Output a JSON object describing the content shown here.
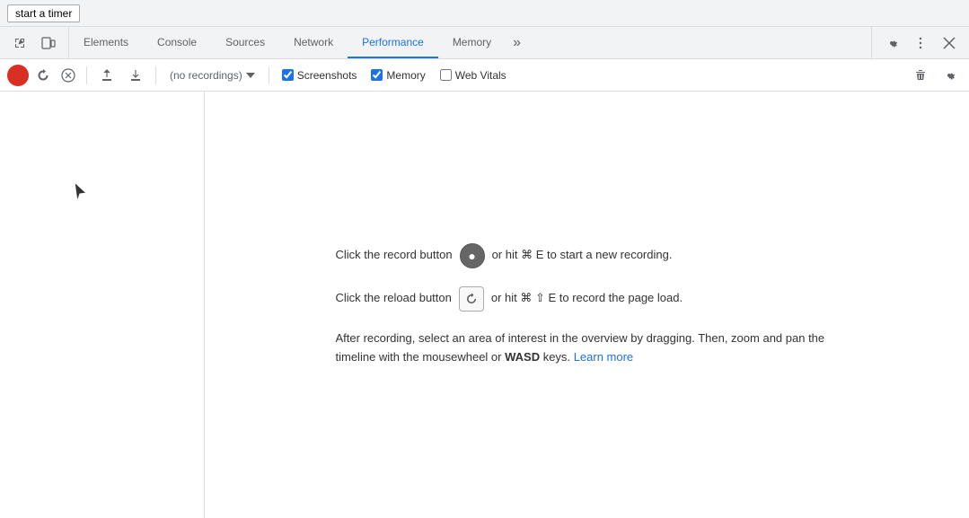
{
  "webpage": {
    "timer_button": "start a timer"
  },
  "devtools": {
    "tabs": [
      {
        "id": "elements",
        "label": "Elements",
        "active": false
      },
      {
        "id": "console",
        "label": "Console",
        "active": false
      },
      {
        "id": "sources",
        "label": "Sources",
        "active": false
      },
      {
        "id": "network",
        "label": "Network",
        "active": false
      },
      {
        "id": "performance",
        "label": "Performance",
        "active": true
      },
      {
        "id": "memory",
        "label": "Memory",
        "active": false
      }
    ],
    "more_tabs_label": "»",
    "settings_tooltip": "Settings",
    "more_options_tooltip": "More options",
    "close_tooltip": "Close DevTools"
  },
  "toolbar": {
    "recordings_placeholder": "(no recordings)",
    "screenshots_label": "Screenshots",
    "screenshots_checked": true,
    "memory_label": "Memory",
    "memory_checked": true,
    "web_vitals_label": "Web Vitals",
    "web_vitals_checked": false
  },
  "instructions": {
    "record_line": "Click the record button",
    "record_shortcut": "or hit ⌘ E to start a new recording.",
    "reload_line": "Click the reload button",
    "reload_shortcut": "or hit ⌘ ⇧ E to record the page load.",
    "note": "After recording, select an area of interest in the overview by dragging. Then, zoom and pan the timeline with the mousewheel or ",
    "note_bold": "WASD",
    "note_end": " keys.",
    "learn_more_label": "Learn more"
  }
}
